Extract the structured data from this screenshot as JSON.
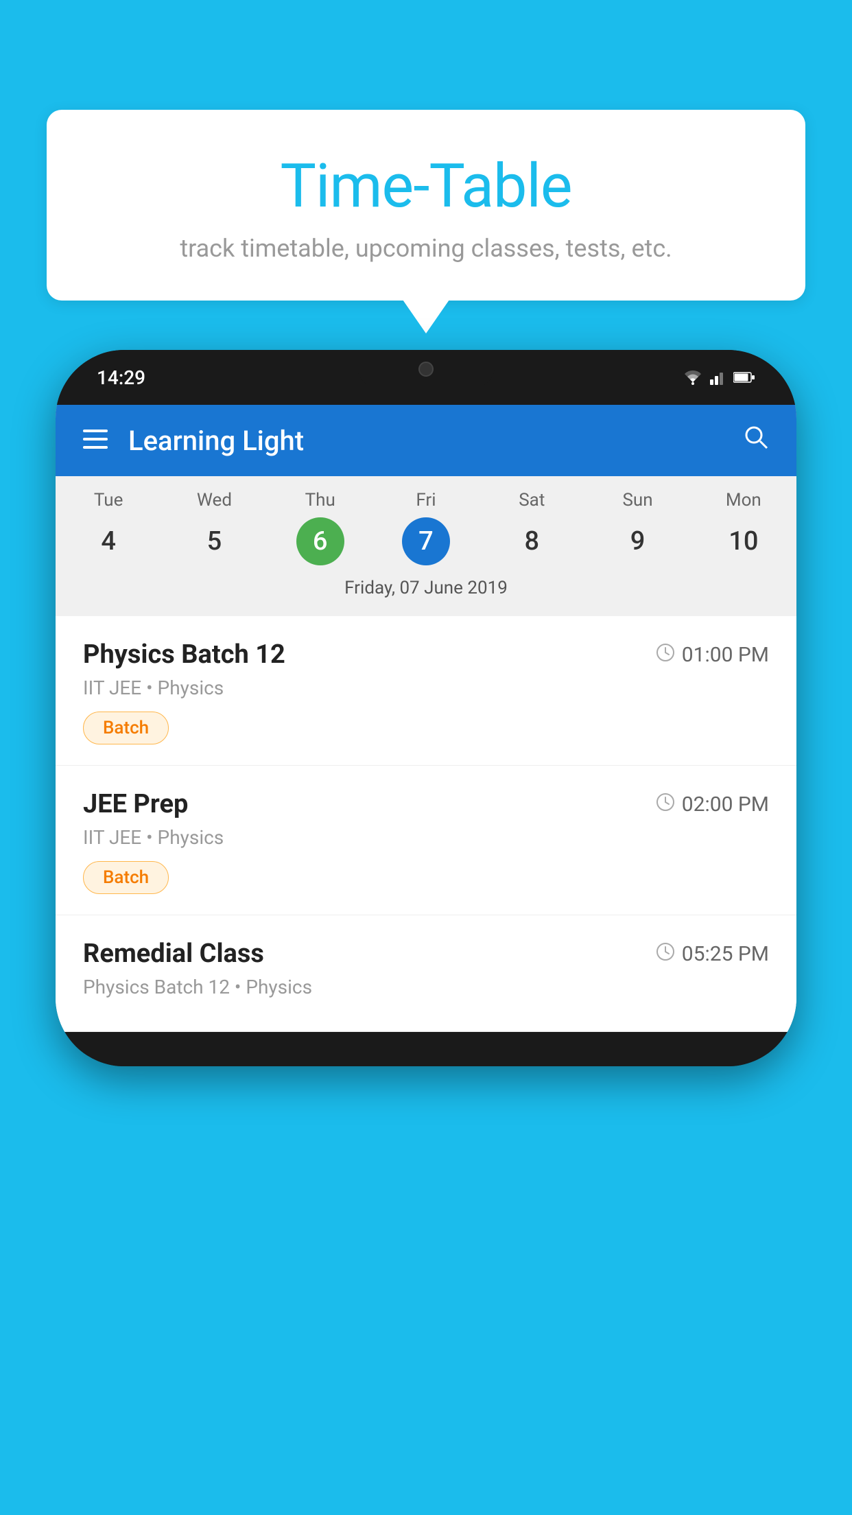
{
  "background_color": "#1BBCEC",
  "speech_bubble": {
    "title": "Time-Table",
    "subtitle": "track timetable, upcoming classes, tests, etc."
  },
  "phone": {
    "status_bar": {
      "time": "14:29"
    },
    "app_header": {
      "title": "Learning Light"
    },
    "calendar": {
      "days_of_week": [
        "Tue",
        "Wed",
        "Thu",
        "Fri",
        "Sat",
        "Sun",
        "Mon"
      ],
      "dates": [
        "4",
        "5",
        "6",
        "7",
        "8",
        "9",
        "10"
      ],
      "today_index": 2,
      "selected_index": 3,
      "selected_date_label": "Friday, 07 June 2019"
    },
    "schedule": [
      {
        "title": "Physics Batch 12",
        "time": "01:00 PM",
        "subtitle": "IIT JEE • Physics",
        "badge": "Batch"
      },
      {
        "title": "JEE Prep",
        "time": "02:00 PM",
        "subtitle": "IIT JEE • Physics",
        "badge": "Batch"
      },
      {
        "title": "Remedial Class",
        "time": "05:25 PM",
        "subtitle": "Physics Batch 12 • Physics",
        "badge": null
      }
    ]
  }
}
